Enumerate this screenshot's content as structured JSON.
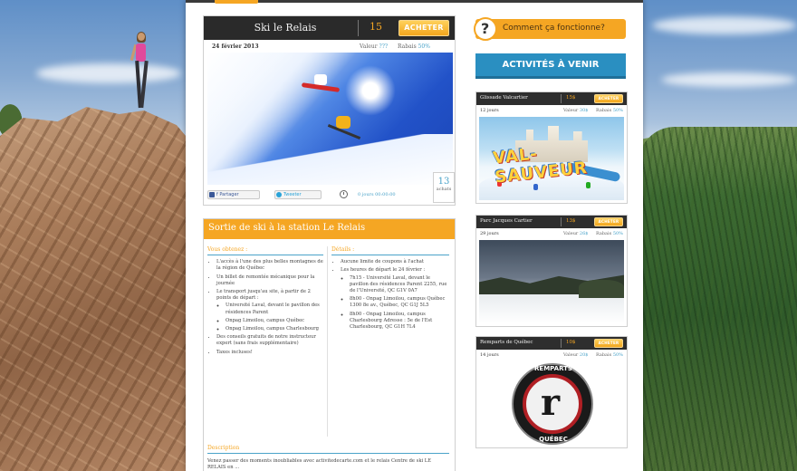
{
  "featured": {
    "title": "Ski le Relais",
    "price": "15",
    "buy_label": "ACHETER",
    "date": "24 février 2013",
    "value_label": "Valeur",
    "value": "???",
    "discount_label": "Rabais",
    "discount": "50%",
    "share_facebook": "f Partager",
    "share_twitter": "Tweeter",
    "time_left": "0 jours 00:00:00",
    "sold_count": "13",
    "sold_label": "achats"
  },
  "description": {
    "title": "Sortie de ski à la station Le Relais",
    "left_heading": "Vous obtenez :",
    "left_items": [
      "L'accès à l'une des plus belles montagnes de la région de Québec",
      "Un billet de remontée mécanique pour la journée",
      "Le transport jusqu'au site, à partir de 2 points de départ :"
    ],
    "left_sub_items": [
      "Université Laval, devant le pavillon des résidences Parent",
      "Onpag Limoilou, campus Québec",
      "Onpag Limoilou, campus Charlesbourg"
    ],
    "left_items_after": [
      "Des conseils gratuits de notre instructeur expert (sans frais supplémentaire)",
      "Taxes incluses!"
    ],
    "right_heading": "Détails :",
    "right_items": [
      "Aucune limite de coupons à l'achat",
      "Les heures de départ le 24 février :"
    ],
    "right_sub_items": [
      "7h15 - Université Laval, devant le pavillon des résidences Parent 2255, rue de l'Université, QC G1V 0A7",
      "8h00 - Onpag Limoilou, campus Québec 1300 8e av., Québec, QC G1J 5L5",
      "8h00 - Onpag Limoilou, campus Charlesbourg Adresse : 5e de l'Est Charlesbourg, QC G1H 7L4"
    ],
    "desc_heading": "Description",
    "desc_text": "Venez passer des moments inoubliables avec activitedecarte.com et le relais Centre de ski LE RELAIS en ..."
  },
  "sidebar": {
    "how_label": "Comment ça fonctionne?",
    "how_icon": "?",
    "upcoming_label": "ACTIVITÉS À VENIR",
    "activities": [
      {
        "name": "Glissade Valcartier",
        "price": "15$",
        "buy_label": "ACHETER",
        "days": "12 jours",
        "value_label": "Valeur",
        "value": "30$",
        "discount_label": "Rabais",
        "discount": "50%"
      },
      {
        "name": "Parc Jacques Cartier",
        "price": "13$",
        "buy_label": "ACHETER",
        "days": "29 jours",
        "value_label": "Valeur",
        "value": "26$",
        "discount_label": "Rabais",
        "discount": "50%"
      },
      {
        "name": "Remparts de Québec",
        "price": "10$",
        "buy_label": "ACHETER",
        "days": "14 jours",
        "value_label": "Valeur",
        "value": "20$",
        "discount_label": "Rabais",
        "discount": "50%"
      }
    ],
    "valcartier_logo": "VAL-SAUVEUR",
    "remparts_top": "REMPARTS",
    "remparts_letter": "r",
    "remparts_bottom": "QUÉBEC"
  },
  "colors": {
    "accent_orange": "#f5a623",
    "accent_blue": "#2a8fc1",
    "header_dark": "#2a2a2a"
  }
}
